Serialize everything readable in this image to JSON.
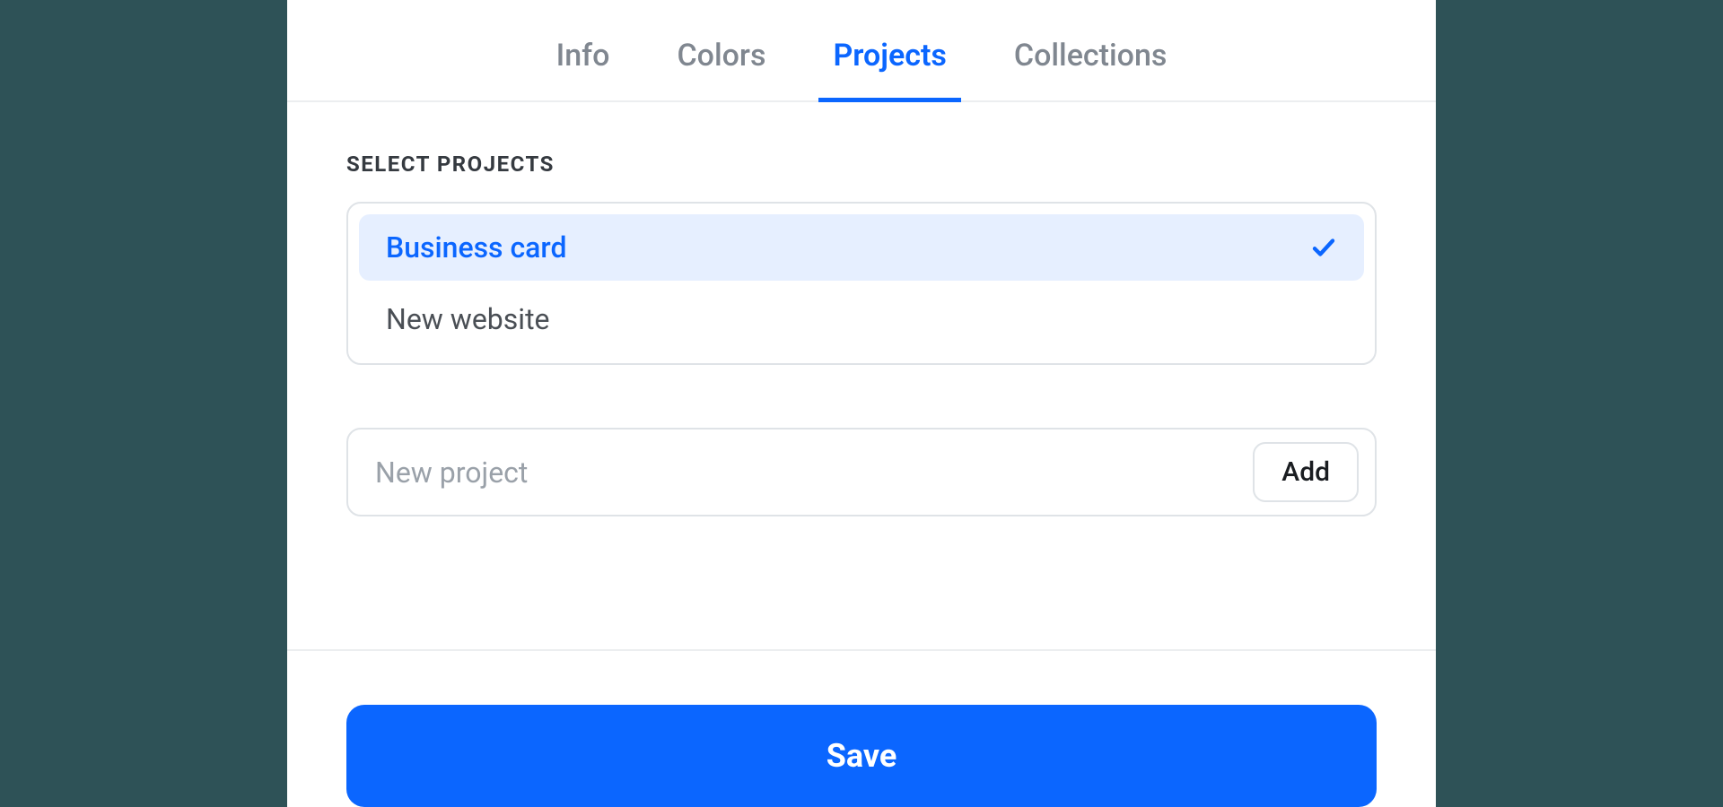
{
  "tabs": [
    {
      "label": "Info",
      "active": false
    },
    {
      "label": "Colors",
      "active": false
    },
    {
      "label": "Projects",
      "active": true
    },
    {
      "label": "Collections",
      "active": false
    }
  ],
  "section_label": "Select Projects",
  "projects": [
    {
      "label": "Business card",
      "selected": true
    },
    {
      "label": "New website",
      "selected": false
    }
  ],
  "new_project": {
    "placeholder": "New project",
    "value": "",
    "add_label": "Add"
  },
  "save_label": "Save"
}
